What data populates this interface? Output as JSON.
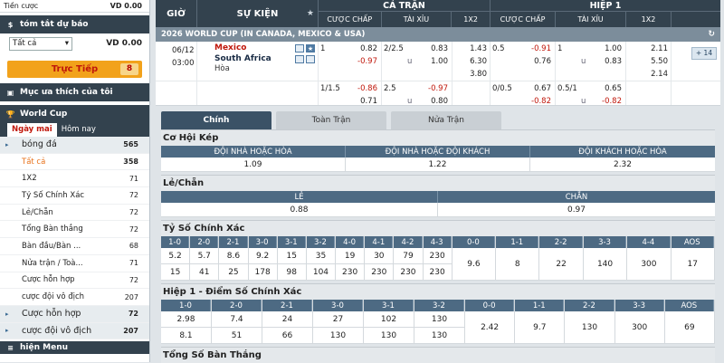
{
  "sidebar": {
    "topline": {
      "label": "Tiền cược",
      "value": "VD 0.00"
    },
    "summary_title": "tóm tắt dự báo",
    "select_value": "Tất cả",
    "balance": "VD 0.00",
    "live_label": "Trực Tiếp",
    "live_count": "8",
    "favorites_title": "Mục ưa thích của tôi",
    "worldcup_title": "World Cup",
    "tabs": [
      "Ngày mai",
      "Hôm nay"
    ],
    "items": [
      {
        "label": "bóng đá",
        "count": "565"
      },
      {
        "label": "Tất cả",
        "count": "358"
      },
      {
        "label": "1X2",
        "count": "71"
      },
      {
        "label": "Tỷ Số Chính Xác",
        "count": "72"
      },
      {
        "label": "Lẻ/Chẵn",
        "count": "72"
      },
      {
        "label": "Tổng Bàn thắng",
        "count": "72"
      },
      {
        "label": "Bàn đầu/Bàn ...",
        "count": "68"
      },
      {
        "label": "Nửa trận / Toà...",
        "count": "71"
      },
      {
        "label": "Cược hỗn hợp",
        "count": "72"
      },
      {
        "label": "cược đội vô địch",
        "count": "207"
      },
      {
        "label": "Cược hỗn hợp",
        "count": "72"
      },
      {
        "label": "cược đội vô địch",
        "count": "207"
      }
    ],
    "bottom_title": "hiện Menu"
  },
  "header": {
    "time": "GIỜ",
    "event": "SỰ KIỆN",
    "star": "★",
    "full": "CẢ TRẬN",
    "half": "HIỆP 1",
    "cols": [
      "CƯỢC CHẤP",
      "TÀI XỈU",
      "1X2",
      "CƯỢC CHẤP",
      "TÀI XỈU",
      "1X2"
    ]
  },
  "league": {
    "name": "2026 WORLD CUP (IN CANADA, MEXICO & USA)",
    "refresh": "↻"
  },
  "match": {
    "date": "06/12",
    "time": "03:00",
    "home": "Mexico",
    "away": "South Africa",
    "draw": "Hòa",
    "badge": "+ 14",
    "row1": {
      "hcap_line": "1",
      "hcap_home": "0.82",
      "hcap_away": "-0.97",
      "ou_line": "2/2.5",
      "ou_u": "u",
      "ou_over": "0.83",
      "ou_under": "1.00",
      "x12": [
        "1.43",
        "6.30",
        "3.80"
      ],
      "h1_hcap_line": "0.5",
      "h1_hcap_home": "-0.91",
      "h1_hcap_away": "0.76",
      "h1_ou_line": "1",
      "h1_ou_u": "u",
      "h1_ou_over": "1.00",
      "h1_ou_under": "0.83",
      "h1_x12": [
        "2.11",
        "5.50",
        "2.14"
      ]
    },
    "row2": {
      "hcap_line": "1/1.5",
      "hcap_home": "-0.86",
      "hcap_away": "0.71",
      "ou_line": "2.5",
      "ou_u": "u",
      "ou_over": "-0.97",
      "ou_under": "0.80",
      "h1_hcap_line": "0/0.5",
      "h1_hcap_home": "0.67",
      "h1_hcap_away": "-0.82",
      "h1_ou_line": "0.5/1",
      "h1_ou_u": "u",
      "h1_ou_over": "0.65",
      "h1_ou_under": "-0.82"
    }
  },
  "nav_tabs": [
    "Chính",
    "Toàn Trận",
    "Nửa Trận"
  ],
  "double_chance": {
    "title": "Cơ Hội Kép",
    "headers": [
      "ĐỘI NHÀ HOẶC HÒA",
      "ĐỘI NHÀ HOẶC ĐỘI KHÁCH",
      "ĐỘI KHÁCH HOẶC HÒA"
    ],
    "values": [
      "1.09",
      "1.22",
      "2.32"
    ]
  },
  "odd_even": {
    "title": "Lẻ/Chẵn",
    "headers": [
      "LẺ",
      "CHẴN"
    ],
    "values": [
      "0.88",
      "0.97"
    ]
  },
  "correct_score": {
    "title": "Tỷ Số Chính Xác",
    "home": [
      {
        "s": "1-0",
        "a": "5.2",
        "b": "15"
      },
      {
        "s": "2-0",
        "a": "5.7",
        "b": "41"
      },
      {
        "s": "2-1",
        "a": "8.6",
        "b": "25"
      },
      {
        "s": "3-0",
        "a": "9.2",
        "b": "178"
      },
      {
        "s": "3-1",
        "a": "15",
        "b": "98"
      },
      {
        "s": "3-2",
        "a": "35",
        "b": "104"
      },
      {
        "s": "4-0",
        "a": "19",
        "b": "230"
      },
      {
        "s": "4-1",
        "a": "30",
        "b": "230"
      },
      {
        "s": "4-2",
        "a": "79",
        "b": "230"
      },
      {
        "s": "4-3",
        "a": "230",
        "b": "230"
      }
    ],
    "draw": [
      {
        "s": "0-0",
        "v": "9.6"
      },
      {
        "s": "1-1",
        "v": "8"
      },
      {
        "s": "2-2",
        "v": "22"
      },
      {
        "s": "3-3",
        "v": "140"
      },
      {
        "s": "4-4",
        "v": "300"
      },
      {
        "s": "AOS",
        "v": "17"
      }
    ]
  },
  "h1_correct_score": {
    "title": "Hiệp 1 - Điểm Số Chính Xác",
    "home": [
      {
        "s": "1-0",
        "a": "2.98",
        "b": "8.1"
      },
      {
        "s": "2-0",
        "a": "7.4",
        "b": "51"
      },
      {
        "s": "2-1",
        "a": "24",
        "b": "66"
      },
      {
        "s": "3-0",
        "a": "27",
        "b": "130"
      },
      {
        "s": "3-1",
        "a": "102",
        "b": "130"
      },
      {
        "s": "3-2",
        "a": "130",
        "b": "130"
      }
    ],
    "draw": [
      {
        "s": "0-0",
        "v": "2.42"
      },
      {
        "s": "1-1",
        "v": "9.7"
      },
      {
        "s": "2-2",
        "v": "130"
      },
      {
        "s": "3-3",
        "v": "300"
      },
      {
        "s": "AOS",
        "v": "69"
      }
    ]
  },
  "total_goals": {
    "title": "Tổng Số Bàn Thắng"
  }
}
